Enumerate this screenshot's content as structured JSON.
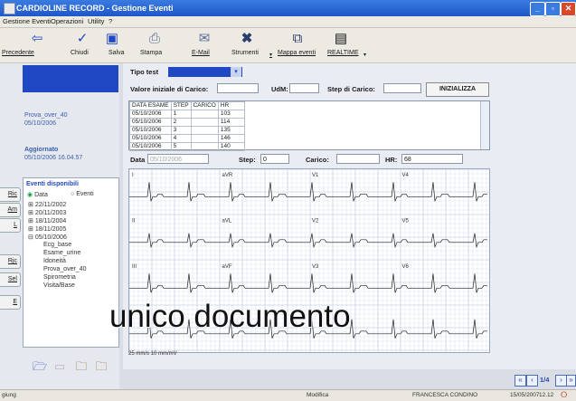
{
  "window": {
    "title": "CARDIOLINE RECORD - Gestione Eventi"
  },
  "menu": [
    "Gestione Eventi",
    "Operazioni",
    "Utility",
    "?"
  ],
  "toolbar": {
    "buttons": [
      {
        "label": "Precedente",
        "icon": "back-arrow-icon"
      },
      {
        "label": "Chiudi",
        "icon": "checkmark-icon"
      },
      {
        "label": "Salva",
        "icon": "save-icon"
      },
      {
        "label": "Stampa",
        "icon": "printer-icon"
      },
      {
        "label": "E-Mail",
        "icon": "email-icon"
      },
      {
        "label": "Strumenti",
        "icon": "tools-icon"
      },
      {
        "label": "Mappa eventi",
        "icon": "map-icon"
      },
      {
        "label": "REALTIME",
        "icon": "monitor-icon"
      }
    ]
  },
  "left": {
    "patient_name": "Prova_over_40",
    "patient_date": "05/10/2006",
    "updated_label": "Aggiornato",
    "updated_value": "05/10/2006 16.04.57",
    "events_title": "Eventi disponibili",
    "sort_date": "Data",
    "sort_events": "Eventi",
    "tree": [
      "22/11/2002",
      "20/11/2003",
      "18/11/2004",
      "18/11/2005",
      "05/10/2006"
    ],
    "subitems": [
      "Ecg_base",
      "Esame_urine",
      "Idoneità",
      "Prova_over_40",
      "Spirometria",
      "Visita/Base"
    ],
    "side_buttons": [
      "Ric",
      "Am",
      "L",
      "Rjc",
      "Sel",
      "E"
    ]
  },
  "main": {
    "tipo_test_label": "Tipo test",
    "valore_label": "Valore iniziale di Carico:",
    "udm_label": "UdM:",
    "step_carico_label": "Step di Carico:",
    "inizializza": "INIZIALIZZA",
    "table_headers": [
      "DATA ESAME",
      "STEP",
      "CARICO",
      "HR"
    ],
    "table_rows": [
      [
        "05/10/2006",
        "1",
        "",
        "103"
      ],
      [
        "05/10/2006",
        "2",
        "",
        "114"
      ],
      [
        "05/10/2006",
        "3",
        "",
        "135"
      ],
      [
        "05/10/2006",
        "4",
        "",
        "146"
      ],
      [
        "05/10/2006",
        "5",
        "",
        "140"
      ]
    ],
    "data_label": "Data",
    "data_value": "05/10/2006",
    "step_label": "Step:",
    "step_value": "0",
    "carico_label": "Carico:",
    "hr_label": "HR:",
    "hr_value": "68",
    "ecg_leads": [
      "I",
      "aVR",
      "V1",
      "V4",
      "II",
      "aVL",
      "V2",
      "V5",
      "III",
      "aVF",
      "V3",
      "V6"
    ],
    "ecg_footer": "25 mm/s 10 mm/mV"
  },
  "overlay_caption": "unico documento",
  "pager": {
    "page": "1/4"
  },
  "status": {
    "left": "giung",
    "mode": "Modifica",
    "user": "FRANCESCA CONDINO",
    "date": "15/05/2007",
    "time": "12.12"
  },
  "colors": {
    "accent_blue": "#2148c4",
    "titlebar": "#2a66d8",
    "grid": "#c7d1e4"
  }
}
